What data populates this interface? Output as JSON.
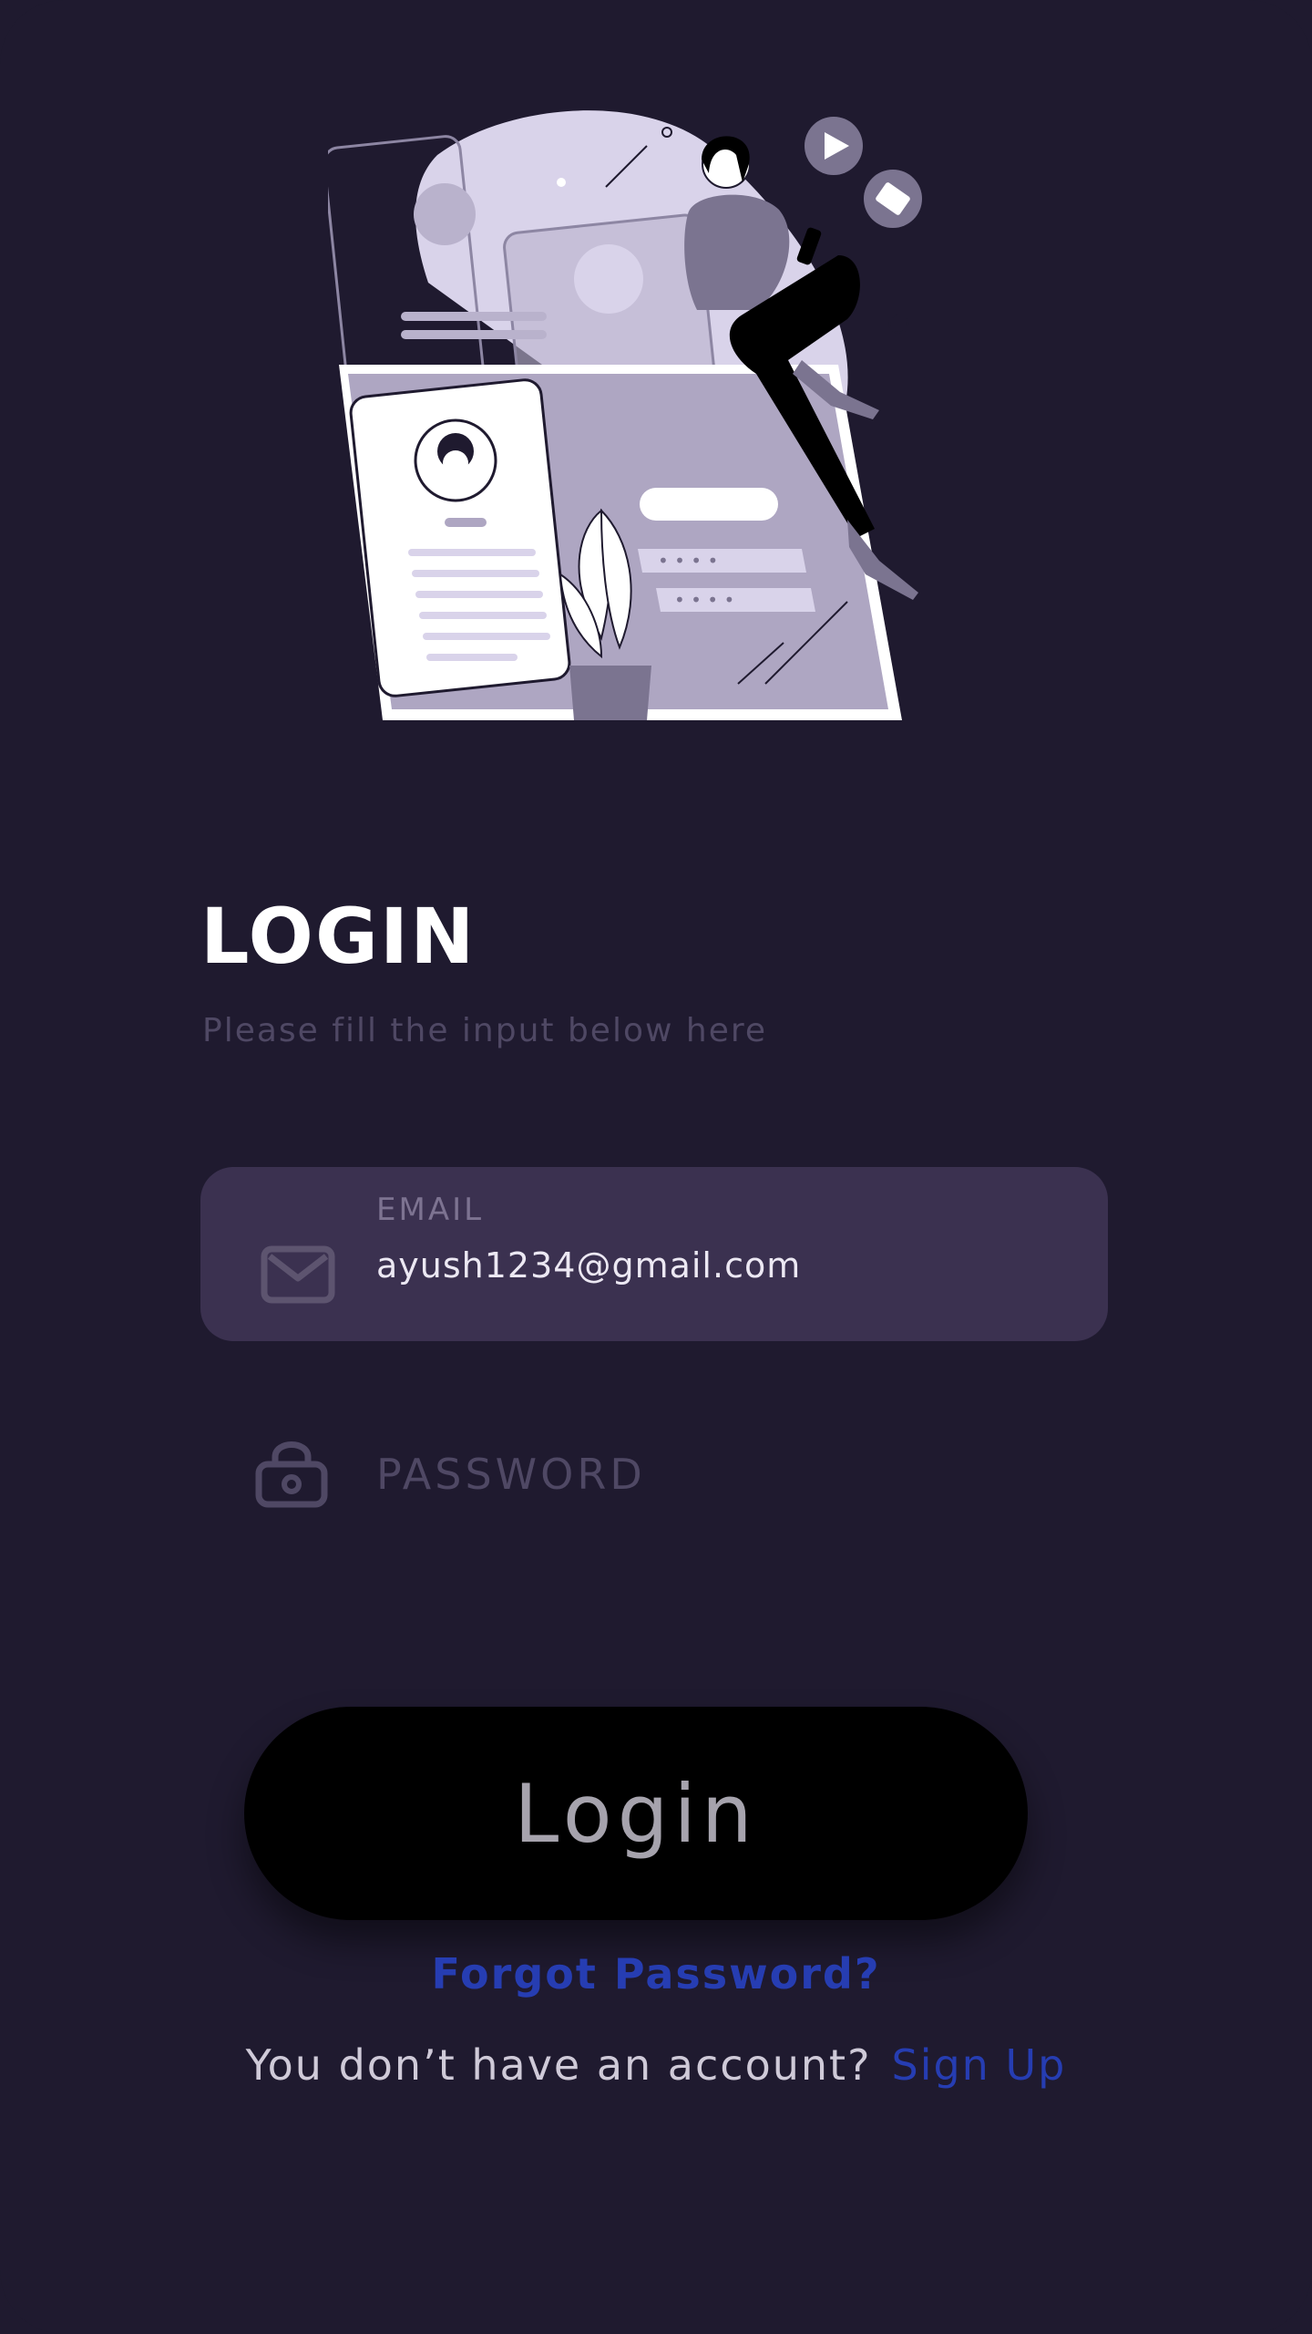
{
  "header": {
    "title": "LOGIN",
    "subtitle": "Please fill the input below here"
  },
  "email": {
    "label": "EMAIL",
    "value": "ayush1234@gmail.com",
    "icon": "mail-icon"
  },
  "password": {
    "label": "PASSWORD",
    "icon": "lock-icon"
  },
  "actions": {
    "login_label": "Login",
    "forgot_label": "Forgot Password?",
    "signup_prompt": "You don’t have an account?",
    "signup_label": "Sign Up"
  },
  "illustration": {
    "icon": "login-illustration",
    "password_mask_1": "• • • •",
    "password_mask_2": "• • • •"
  },
  "colors": {
    "background": "#1f1a2f",
    "input_fill": "#3b3150",
    "button": "#000000",
    "link": "#263db2",
    "illustration_lavender": "#d9d3ea",
    "illustration_slate": "#7b7490"
  }
}
